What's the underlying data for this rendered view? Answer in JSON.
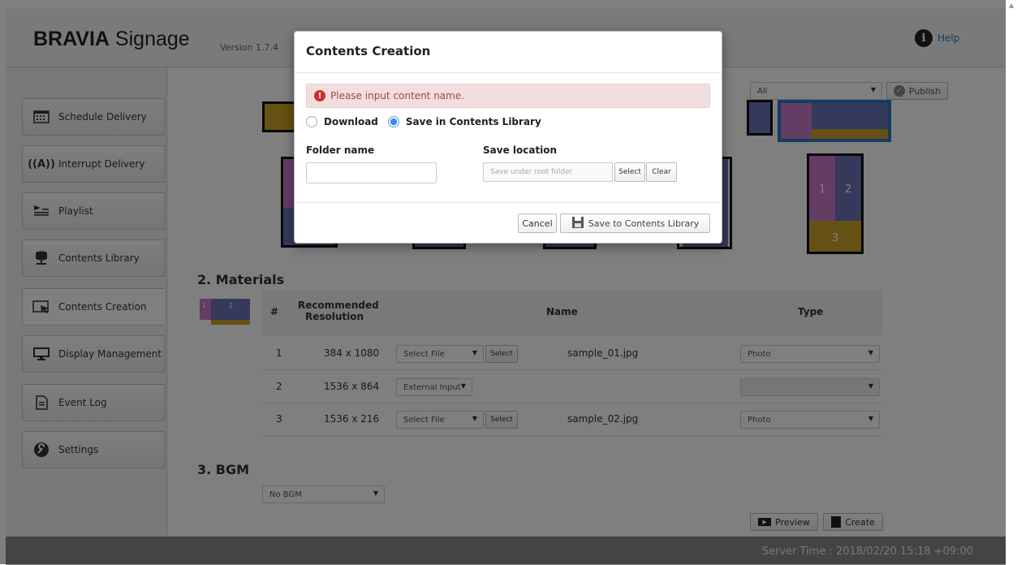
{
  "header": {
    "brand_bold": "BRAVIA",
    "brand_rest": " Signage",
    "version": "Version 1.7.4",
    "help_label": "Help"
  },
  "sidebar": {
    "items": [
      {
        "label": "Schedule Delivery",
        "icon": "calendar-icon"
      },
      {
        "label": "Interrupt Delivery",
        "icon": "broadcast-icon"
      },
      {
        "label": "Playlist",
        "icon": "playlist-icon"
      },
      {
        "label": "Contents Library",
        "icon": "library-icon"
      },
      {
        "label": "Contents Creation",
        "icon": "contents-creation-icon"
      },
      {
        "label": "Display Management",
        "icon": "monitor-icon"
      },
      {
        "label": "Event Log",
        "icon": "document-icon"
      },
      {
        "label": "Settings",
        "icon": "wrench-icon"
      }
    ]
  },
  "toolbar": {
    "filter_value": "All",
    "publish_label": "Publish"
  },
  "layout_preview": {
    "zone_labels": [
      "1",
      "2",
      "3"
    ]
  },
  "materials": {
    "title": "2. Materials",
    "thumb_labels": [
      "1",
      "2"
    ],
    "headers": {
      "num": "#",
      "resolution": "Recommended Resolution",
      "name": "Name",
      "type": "Type"
    },
    "rows": [
      {
        "num": "1",
        "resolution": "384 x 1080",
        "source": "Select File",
        "select_btn": "Select",
        "name": "sample_01.jpg",
        "type": "Photo"
      },
      {
        "num": "2",
        "resolution": "1536 x 864",
        "source": "External Input",
        "select_btn": "",
        "name": "",
        "type": ""
      },
      {
        "num": "3",
        "resolution": "1536 x 216",
        "source": "Select File",
        "select_btn": "Select",
        "name": "sample_02.jpg",
        "type": "Photo"
      }
    ]
  },
  "bgm": {
    "title": "3. BGM",
    "value": "No BGM"
  },
  "actions": {
    "preview_label": "Preview",
    "create_label": "Create"
  },
  "footer": {
    "server_time": "Server Time : 2018/02/20 15:18 +09:00"
  },
  "modal": {
    "title": "Contents Creation",
    "alert": "Please input content name.",
    "radio_download": "Download",
    "radio_save": "Save in Contents Library",
    "folder_label": "Folder name",
    "folder_value": "",
    "save_location_label": "Save location",
    "save_location_placeholder": "Save under root folder",
    "select_label": "Select",
    "clear_label": "Clear",
    "cancel_label": "Cancel",
    "save_label": "Save to Contents Library"
  },
  "colors": {
    "zone_gold": "#c9a227",
    "zone_pink": "#c77ac9",
    "zone_blue": "#6a72b8",
    "selected_blue": "#2a78c5",
    "alert_bg": "#f2dede",
    "alert_text": "#a94442"
  }
}
